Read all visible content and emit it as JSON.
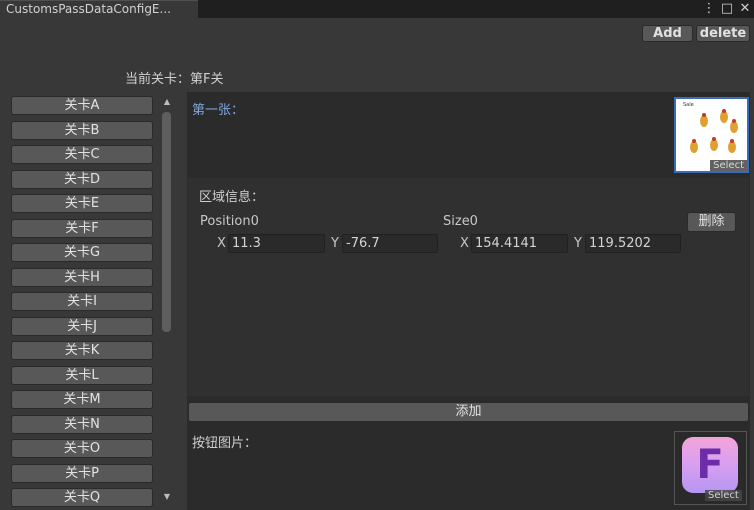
{
  "window": {
    "tab_title": "CustomsPassDataConfigE...",
    "menu_icon": "⋮",
    "maximize_icon": "□",
    "close_icon": "✕"
  },
  "toolbar": {
    "add_label": "Add",
    "delete_label": "delete"
  },
  "current_level": "当前关卡：第F关",
  "levels": [
    "关卡A",
    "关卡B",
    "关卡C",
    "关卡D",
    "关卡E",
    "关卡F",
    "关卡G",
    "关卡H",
    "关卡I",
    "关卡J",
    "关卡K",
    "关卡L",
    "关卡M",
    "关卡N",
    "关卡O",
    "关卡P",
    "关卡Q"
  ],
  "scroll": {
    "up_icon": "▲",
    "down_icon": "▼"
  },
  "page": {
    "first_label": "第一张：",
    "select_label": "Select",
    "region": {
      "title": "区域信息：",
      "position_label": "Position0",
      "size_label": "Size0",
      "delete_label": "删除",
      "x_axis": "X",
      "y_axis": "Y",
      "pos_x": "11.3",
      "pos_y": "-76.7",
      "size_x": "154.4141",
      "size_y": "119.5202"
    },
    "add_label": "添加",
    "button_image_label": "按钮图片：",
    "badge_letter": "F"
  }
}
